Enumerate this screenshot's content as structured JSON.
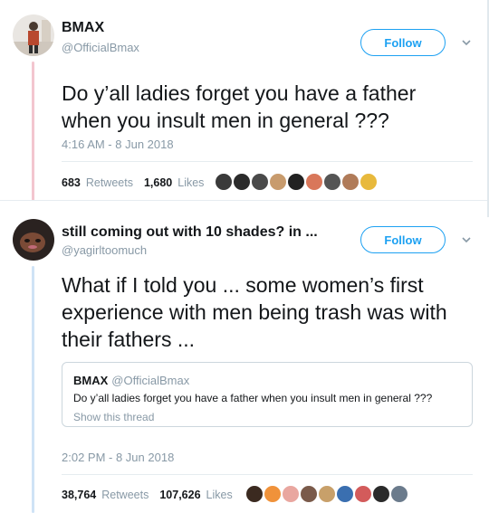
{
  "tweet1": {
    "display_name": "BMAX",
    "handle": "@OfficialBmax",
    "follow_label": "Follow",
    "text": "Do y’all ladies forget you have a father when you insult men in general ???",
    "timestamp": "4:16 AM - 8 Jun 2018",
    "retweets_count": "683",
    "retweets_label": "Retweets",
    "likes_count": "1,680",
    "likes_label": "Likes",
    "liker_colors": [
      "#3a3a3a",
      "#2b2b2b",
      "#4a4a4a",
      "#c89b6d",
      "#222222",
      "#d9775a",
      "#555555",
      "#b07b59",
      "#e8b93c"
    ]
  },
  "tweet2": {
    "display_name": "still coming out with 10 shades? in ...",
    "handle": "@yagirltoomuch",
    "follow_label": "Follow",
    "text": "What if I told you ... some women’s first experience with men being trash was with their fathers ...",
    "timestamp": "2:02 PM - 8 Jun 2018",
    "retweets_count": "38,764",
    "retweets_label": "Retweets",
    "likes_count": "107,626",
    "likes_label": "Likes",
    "liker_colors": [
      "#3b2a20",
      "#f0923a",
      "#e9a7a0",
      "#7a5a4a",
      "#c8a06a",
      "#3a6fb0",
      "#d35b5b",
      "#2a2a2a",
      "#6b7b8c"
    ],
    "quote": {
      "display_name": "BMAX",
      "handle": "@OfficialBmax",
      "text": "Do y’all ladies forget you have a father when you insult men in general ???",
      "show_thread": "Show this thread"
    }
  },
  "colors": {
    "thread_line_1": "#f3c6cf",
    "thread_line_2": "#cfe3f6",
    "accent": "#1da1f2"
  }
}
